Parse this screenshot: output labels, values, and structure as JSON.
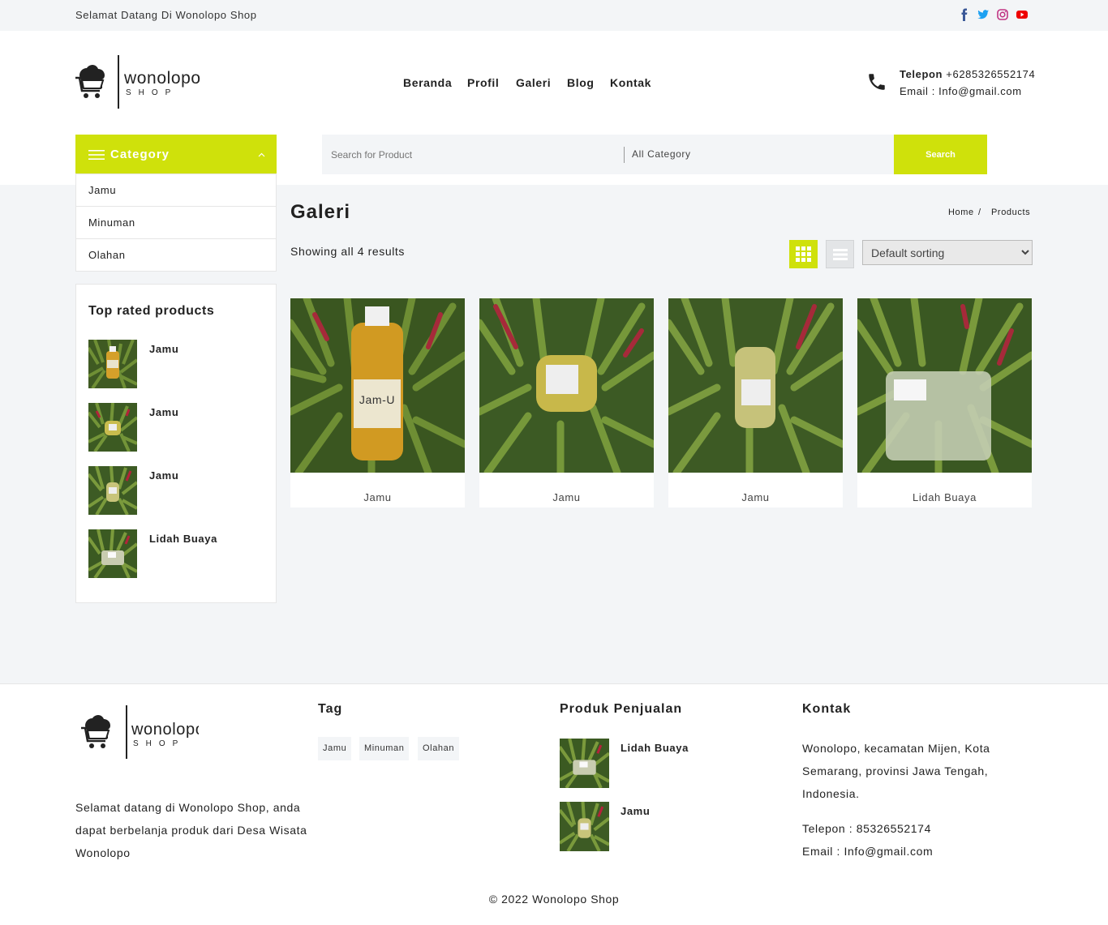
{
  "topbar": {
    "welcome": "Selamat Datang Di Wonolopo Shop",
    "social": [
      "facebook-icon",
      "twitter-icon",
      "instagram-icon",
      "youtube-icon"
    ]
  },
  "brand": {
    "name": "wonolopo",
    "tagline": "SHOP"
  },
  "nav": [
    "Beranda",
    "Profil",
    "Galeri",
    "Blog",
    "Kontak"
  ],
  "header_contact": {
    "phone_label": "Telepon",
    "phone": "+6285326552174",
    "email": "Email : Info@gmail.com"
  },
  "category": {
    "label": "Category",
    "items": [
      "Jamu",
      "Minuman",
      "Olahan"
    ]
  },
  "search": {
    "placeholder": "Search for Product",
    "category": "All Category",
    "button": "Search"
  },
  "sidebar": {
    "top_rated_title": "Top rated products",
    "top_rated": [
      {
        "name": "Jamu"
      },
      {
        "name": "Jamu"
      },
      {
        "name": "Jamu"
      },
      {
        "name": "Lidah Buaya"
      }
    ]
  },
  "main": {
    "title": "Galeri",
    "breadcrumb": {
      "home": "Home",
      "sep": "/",
      "current": "Products"
    },
    "results": "Showing all 4 results",
    "sort": "Default sorting",
    "products": [
      {
        "name": "Jamu"
      },
      {
        "name": "Jamu"
      },
      {
        "name": "Jamu"
      },
      {
        "name": "Lidah Buaya"
      }
    ]
  },
  "footer": {
    "about": "Selamat datang di Wonolopo Shop, anda dapat berbelanja produk dari Desa Wisata Wonolopo",
    "tag_title": "Tag",
    "tags": [
      "Jamu",
      "Minuman",
      "Olahan"
    ],
    "produk_title": "Produk Penjualan",
    "produk": [
      {
        "name": "Lidah Buaya"
      },
      {
        "name": "Jamu"
      }
    ],
    "kontak_title": "Kontak",
    "address": "Wonolopo, kecamatan Mijen, Kota Semarang, provinsi Jawa Tengah, Indonesia.",
    "phone": "Telepon : 85326552174",
    "email": "Email : Info@gmail.com",
    "copyright": "© 2022 Wonolopo Shop"
  },
  "colors": {
    "accent": "#cfe10b",
    "bg_light": "#f3f5f7"
  }
}
